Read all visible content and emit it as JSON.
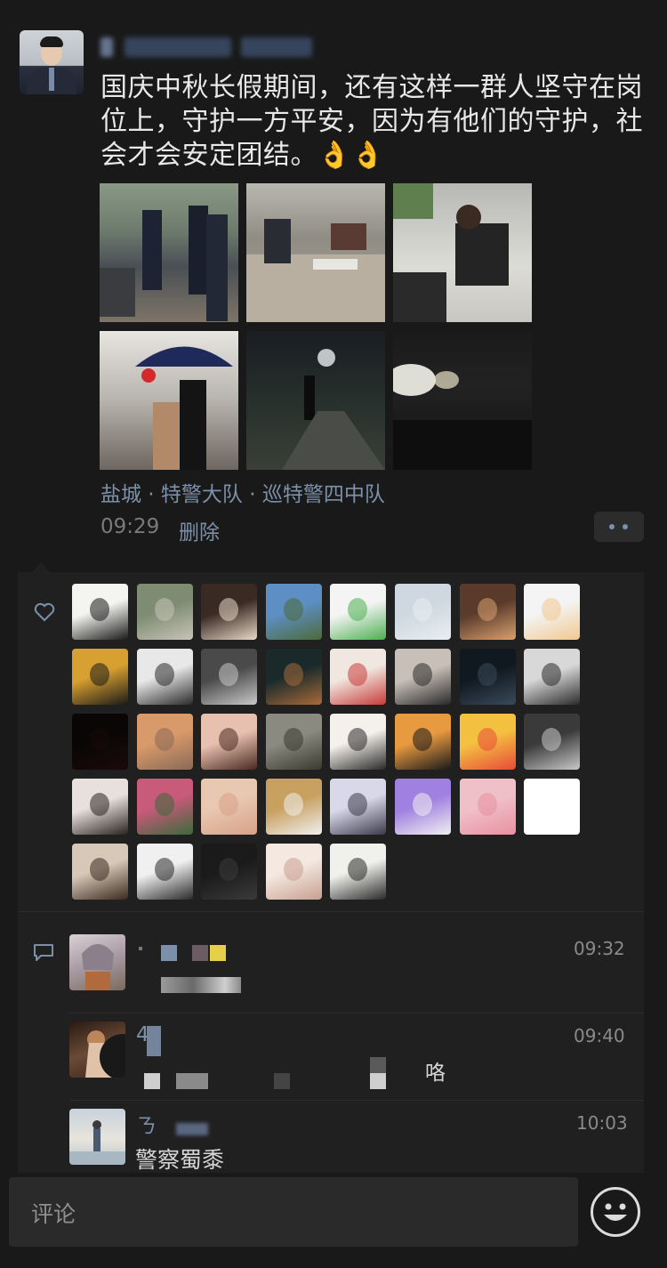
{
  "post": {
    "author_avatar_icon": "man-in-suit-avatar",
    "text": "国庆中秋长假期间，还有这样一群人坚守在岗位上，守护一方平安，因为有他们的守护，社会才会安定团结。👌👌",
    "photos": [
      {
        "icon": "officers-street-photo"
      },
      {
        "icon": "office-meeting-photo"
      },
      {
        "icon": "officer-at-computer-photo"
      },
      {
        "icon": "officers-under-umbrella-photo"
      },
      {
        "icon": "night-patrol-photo"
      },
      {
        "icon": "night-road-lights-photo"
      }
    ],
    "location": "盐城 · 特警大队 · 巡特警四中队",
    "time": "09:29",
    "delete_label": "删除"
  },
  "likes": {
    "icon": "heart-icon",
    "count": 37
  },
  "comments": [
    {
      "time": "09:32",
      "avatar_icon": "anime-girl-avatar",
      "text": ""
    },
    {
      "time": "09:40",
      "avatar_icon": "hand-photo-avatar",
      "name": "4",
      "text": "咯"
    },
    {
      "time": "10:03",
      "avatar_icon": "beach-figure-avatar",
      "name": "ㄋ",
      "text": "警察蜀黍"
    }
  ],
  "comment_icon": "comment-bubble-icon",
  "composer": {
    "placeholder": "评论",
    "emoji_icon": "smiley-face-icon"
  },
  "colors": {
    "background": "#191919",
    "link": "#7d90a9",
    "panel": "#202020"
  }
}
